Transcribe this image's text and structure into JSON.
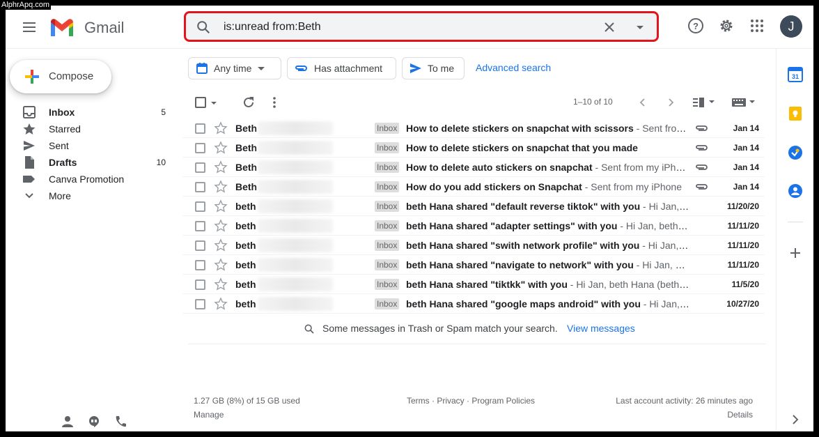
{
  "watermark": "AlphrApq.com",
  "header": {
    "brand": "Gmail",
    "search_query": "is:unread from:Beth",
    "avatar_initial": "J"
  },
  "sidebar": {
    "compose_label": "Compose",
    "items": [
      {
        "label": "Inbox",
        "count": "5",
        "bold": true,
        "icon": "inbox-icon"
      },
      {
        "label": "Starred",
        "count": "",
        "bold": false,
        "icon": "star-icon"
      },
      {
        "label": "Sent",
        "count": "",
        "bold": false,
        "icon": "send-icon"
      },
      {
        "label": "Drafts",
        "count": "10",
        "bold": true,
        "icon": "draft-icon"
      },
      {
        "label": "Canva Promotion",
        "count": "",
        "bold": false,
        "icon": "label-icon"
      },
      {
        "label": "More",
        "count": "",
        "bold": false,
        "icon": "chevron-down-icon"
      }
    ]
  },
  "filters": {
    "any_time": "Any time",
    "has_attachment": "Has attachment",
    "to_me": "To me",
    "advanced_search": "Advanced search"
  },
  "toolbar": {
    "range": "1–10 of 10"
  },
  "emails": [
    {
      "sender": "Beth",
      "label": "Inbox",
      "subject": "How to delete stickers on snapchat with scissors",
      "snippet": " - Sent from my iPhone",
      "attachment": true,
      "date": "Jan 14"
    },
    {
      "sender": "Beth",
      "label": "Inbox",
      "subject": "How to delete stickers on snapchat that you made",
      "snippet": "",
      "attachment": true,
      "date": "Jan 14"
    },
    {
      "sender": "Beth",
      "label": "Inbox",
      "subject": "How to delete auto stickers on snapchat",
      "snippet": " - Sent from my iPhone",
      "attachment": true,
      "date": "Jan 14"
    },
    {
      "sender": "Beth",
      "label": "Inbox",
      "subject": "How do you add stickers on Snapchat",
      "snippet": " - Sent from my iPhone",
      "attachment": true,
      "date": "Jan 14"
    },
    {
      "sender": "beth",
      "label": "Inbox",
      "subject": "beth Hana shared \"default reverse tiktok\" with you",
      "snippet": " - Hi Jan, beth Hana",
      "attachment": false,
      "date": "11/20/20"
    },
    {
      "sender": "beth",
      "label": "Inbox",
      "subject": "beth Hana shared \"adapter settings\" with you",
      "snippet": " - Hi Jan, beth Hana",
      "attachment": false,
      "date": "11/11/20"
    },
    {
      "sender": "beth",
      "label": "Inbox",
      "subject": "beth Hana shared \"swith network profile\" with you",
      "snippet": " - Hi Jan, beth Hana",
      "attachment": false,
      "date": "11/11/20"
    },
    {
      "sender": "beth",
      "label": "Inbox",
      "subject": "beth Hana shared \"navigate to network\" with you",
      "snippet": " - Hi Jan, beth Hana",
      "attachment": false,
      "date": "11/11/20"
    },
    {
      "sender": "beth",
      "label": "Inbox",
      "subject": "beth Hana shared \"tiktkk\" with you",
      "snippet": " - Hi Jan, beth Hana (bethhana",
      "attachment": false,
      "date": "11/5/20"
    },
    {
      "sender": "beth",
      "label": "Inbox",
      "subject": "beth Hana shared \"google maps android\" with you",
      "snippet": " - Hi Jan, beth Hana",
      "attachment": false,
      "date": "10/27/20"
    }
  ],
  "notice": {
    "text": "Some messages in Trash or Spam match your search.",
    "link": "View messages"
  },
  "footer": {
    "storage": "1.27 GB (8%) of 15 GB used",
    "manage": "Manage",
    "terms": "Terms · Privacy · Program Policies",
    "activity": "Last account activity: 26 minutes ago",
    "details": "Details"
  },
  "colors": {
    "search_highlight": "#e3141c",
    "link": "#1a73e8",
    "accent_blue": "#1a73e8"
  }
}
